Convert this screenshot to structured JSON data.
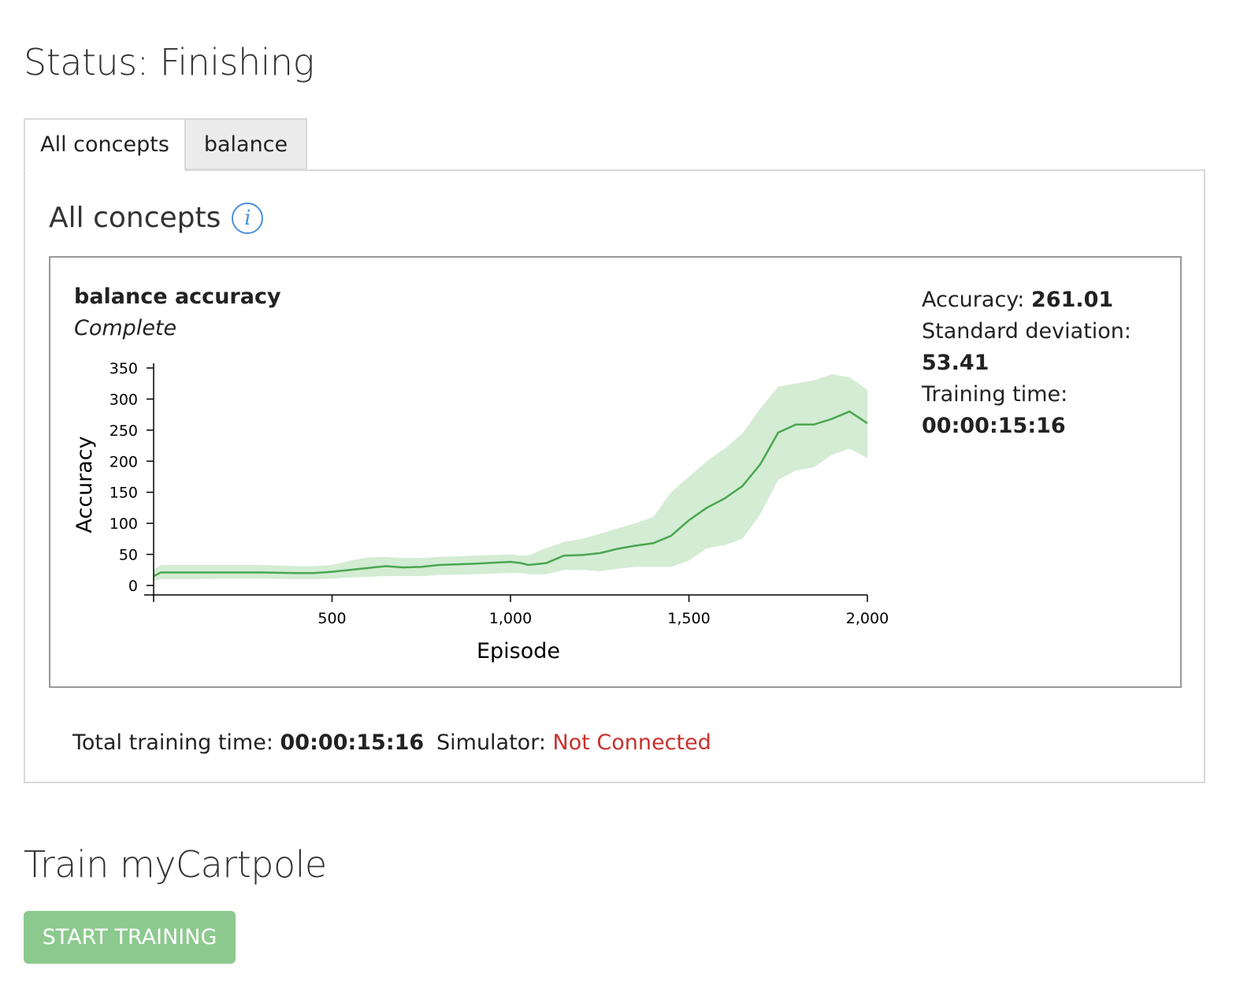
{
  "status": {
    "label": "Status:",
    "value": "Finishing"
  },
  "tabs": [
    {
      "label": "All concepts",
      "active": true
    },
    {
      "label": "balance",
      "active": false
    }
  ],
  "panel": {
    "heading": "All concepts",
    "info_icon": "info-icon",
    "card": {
      "title": "balance accuracy",
      "subtitle": "Complete",
      "stats": {
        "accuracy_label": "Accuracy:",
        "accuracy_value": "261.01",
        "std_label": "Standard deviation:",
        "std_value": "53.41",
        "training_time_label": "Training time:",
        "training_time_value": "00:00:15:16"
      }
    },
    "footer": {
      "total_time_label": "Total training time:",
      "total_time_value": "00:00:15:16",
      "simulator_label": "Simulator:",
      "simulator_value": "Not Connected"
    }
  },
  "train": {
    "title": "Train myCartpole",
    "start_button_label": "START TRAINING"
  },
  "colors": {
    "line": "#4aa64f",
    "band": "#d3ecd3",
    "not_connected": "#c9302c",
    "button": "#8cc98e",
    "info": "#4a90d9"
  },
  "chart_data": {
    "type": "line",
    "xlabel": "Episode",
    "ylabel": "Accuracy",
    "xlim": [
      0,
      2000
    ],
    "ylim": [
      0,
      350
    ],
    "x_ticks": [
      500,
      1000,
      1500,
      2000
    ],
    "x_tick_labels": [
      "500",
      "1,000",
      "1,500",
      "2,000"
    ],
    "y_ticks": [
      0,
      50,
      100,
      150,
      200,
      250,
      300,
      350
    ],
    "y_tick_labels": [
      "0",
      "50",
      "100",
      "150",
      "200",
      "250",
      "300",
      "350"
    ],
    "grid": false,
    "series": [
      {
        "x": [
          0,
          20,
          100,
          200,
          300,
          400,
          450,
          500,
          550,
          600,
          650,
          700,
          750,
          800,
          900,
          1000,
          1030,
          1050,
          1100,
          1150,
          1200,
          1250,
          1300,
          1350,
          1400,
          1450,
          1500,
          1550,
          1600,
          1650,
          1700,
          1750,
          1800,
          1850,
          1900,
          1950,
          2000
        ],
        "y": [
          15,
          21,
          21,
          21,
          21,
          20,
          20,
          22,
          25,
          28,
          31,
          29,
          30,
          33,
          35,
          38,
          36,
          33,
          36,
          48,
          49,
          52,
          59,
          64,
          68,
          80,
          105,
          125,
          140,
          160,
          195,
          246,
          259,
          259,
          268,
          280,
          261
        ],
        "band_upper": [
          25,
          33,
          33,
          33,
          33,
          31,
          31,
          33,
          40,
          45,
          46,
          44,
          44,
          46,
          48,
          50,
          48,
          48,
          60,
          70,
          75,
          83,
          92,
          100,
          110,
          150,
          175,
          200,
          220,
          245,
          285,
          320,
          325,
          330,
          340,
          335,
          315
        ],
        "band_lower": [
          8,
          10,
          10,
          11,
          11,
          10,
          10,
          11,
          13,
          14,
          15,
          15,
          15,
          17,
          18,
          20,
          20,
          18,
          18,
          25,
          25,
          23,
          27,
          30,
          30,
          30,
          40,
          60,
          65,
          75,
          115,
          170,
          185,
          190,
          210,
          220,
          205
        ]
      }
    ]
  }
}
